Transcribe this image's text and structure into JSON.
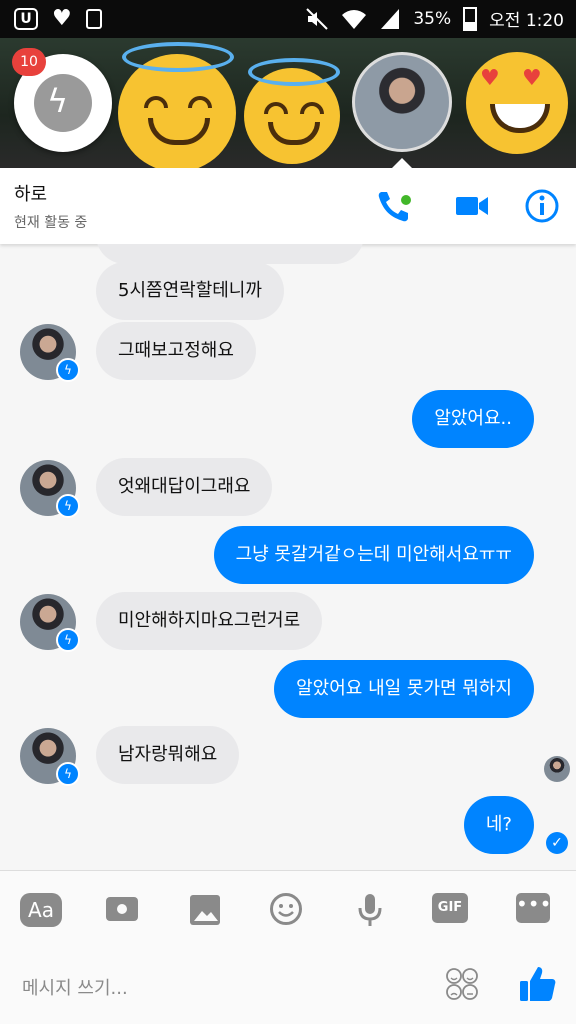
{
  "status_bar": {
    "battery": "35%",
    "time": "오전 1:20",
    "icons": [
      "u-plus-icon",
      "heart-icon",
      "clipboard-icon",
      "mute-icon",
      "wifi-icon",
      "signal-icon",
      "battery-icon"
    ]
  },
  "chat_heads": {
    "badge_count": "10",
    "heads": [
      "messenger-head",
      "halo-smile-head",
      "halo-smile-head",
      "photo-head",
      "heart-eyes-head"
    ]
  },
  "header": {
    "name": "하로",
    "status": "현재 활동 중"
  },
  "messages": [
    {
      "dir": "in",
      "text": "5시쯤연락할테니까"
    },
    {
      "dir": "in",
      "text": "그때보고정해요"
    },
    {
      "dir": "out",
      "text": "알았어요.."
    },
    {
      "dir": "in",
      "text": "엇왜대답이그래요"
    },
    {
      "dir": "out",
      "text": "그냥 못갈거같ㅇ는데 미안해서요ㅠㅠ"
    },
    {
      "dir": "in",
      "text": "미안해하지마요그런거로"
    },
    {
      "dir": "out",
      "text": "알았어요 내일 못가면 뭐하지"
    },
    {
      "dir": "in",
      "text": "남자랑뭐해요"
    },
    {
      "dir": "out",
      "text": "네?"
    }
  ],
  "toolbar": {
    "aa_label": "Aa",
    "gif_label": "GIF",
    "more_label": "•••"
  },
  "composer": {
    "placeholder": "메시지 쓰기..."
  },
  "colors": {
    "accent": "#0084ff",
    "incoming": "#e9e9eb",
    "badge": "#e8413c"
  }
}
